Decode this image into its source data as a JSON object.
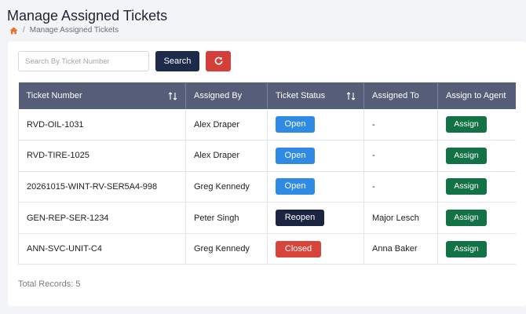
{
  "page": {
    "title": "Manage Assigned Tickets"
  },
  "breadcrumb": {
    "separator": "/",
    "current": "Manage Assigned Tickets",
    "home_icon": "home-icon"
  },
  "search": {
    "placeholder": "Search By Ticket Number",
    "value": "",
    "button_label": "Search",
    "refresh_icon": "refresh-icon"
  },
  "table": {
    "headers": {
      "ticket_number": "Ticket Number",
      "assigned_by": "Assigned By",
      "ticket_status": "Ticket Status",
      "assigned_to": "Assigned To",
      "assign_to_agent": "Assign to Agent"
    },
    "rows": [
      {
        "ticket_number": "RVD-OIL-1031",
        "assigned_by": "Alex Draper",
        "status": "Open",
        "assigned_to": "-",
        "action": "Assign"
      },
      {
        "ticket_number": "RVD-TIRE-1025",
        "assigned_by": "Alex Draper",
        "status": "Open",
        "assigned_to": "-",
        "action": "Assign"
      },
      {
        "ticket_number": "20261015-WINT-RV-SER5A4-998",
        "assigned_by": "Greg Kennedy",
        "status": "Open",
        "assigned_to": "-",
        "action": "Assign"
      },
      {
        "ticket_number": "GEN-REP-SER-1234",
        "assigned_by": "Peter Singh",
        "status": "Reopen",
        "assigned_to": "Major Lesch",
        "action": "Assign"
      },
      {
        "ticket_number": "ANN-SVC-UNIT-C4",
        "assigned_by": "Greg Kennedy",
        "status": "Closed",
        "assigned_to": "Anna Baker",
        "action": "Assign"
      }
    ]
  },
  "footer": {
    "total_records": "Total Records: 5"
  },
  "colors": {
    "header_bg": "#555d78",
    "search_button": "#1e2a4a",
    "refresh_button": "#d43f3a",
    "open": "#2f8ae6",
    "reopen": "#1b2440",
    "closed": "#d7443a",
    "assign": "#127245"
  }
}
